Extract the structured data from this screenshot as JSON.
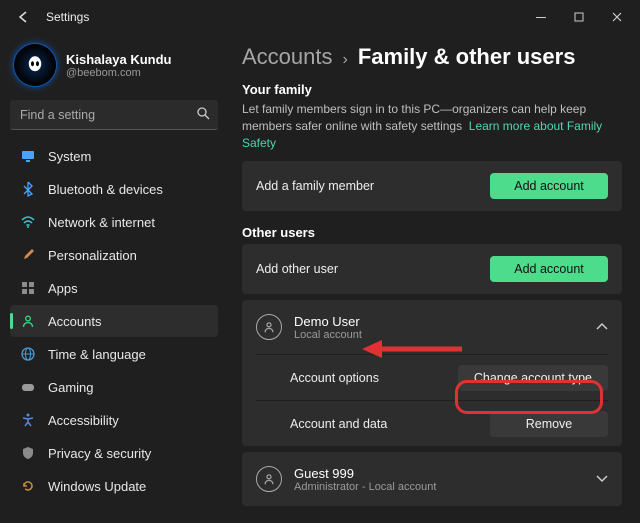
{
  "window": {
    "title": "Settings"
  },
  "user": {
    "name": "Kishalaya Kundu",
    "email": "@beebom.com"
  },
  "search": {
    "placeholder": "Find a setting"
  },
  "nav": [
    {
      "key": "system",
      "label": "System",
      "icon": "monitor",
      "color": "#4aa3ff"
    },
    {
      "key": "bluetooth",
      "label": "Bluetooth & devices",
      "icon": "bt",
      "color": "#4aa3ff"
    },
    {
      "key": "network",
      "label": "Network & internet",
      "icon": "wifi",
      "color": "#38c6c6"
    },
    {
      "key": "personalization",
      "label": "Personalization",
      "icon": "brush",
      "color": "#d08a4a"
    },
    {
      "key": "apps",
      "label": "Apps",
      "icon": "grid",
      "color": "#8c8c8c"
    },
    {
      "key": "accounts",
      "label": "Accounts",
      "icon": "person",
      "color": "#36d07a",
      "active": true
    },
    {
      "key": "time",
      "label": "Time & language",
      "icon": "globe",
      "color": "#4a9ad0"
    },
    {
      "key": "gaming",
      "label": "Gaming",
      "icon": "gamepad",
      "color": "#9a9a9a"
    },
    {
      "key": "accessibility",
      "label": "Accessibility",
      "icon": "access",
      "color": "#5a8ad0"
    },
    {
      "key": "privacy",
      "label": "Privacy & security",
      "icon": "shield",
      "color": "#8a8a8a"
    },
    {
      "key": "update",
      "label": "Windows Update",
      "icon": "refresh",
      "color": "#c4903a"
    }
  ],
  "breadcrumb": {
    "root": "Accounts",
    "sep": "›",
    "current": "Family & other users"
  },
  "family": {
    "heading": "Your family",
    "desc": "Let family members sign in to this PC—organizers can help keep members safer online with safety settings",
    "link": "Learn more about Family Safety",
    "add_label": "Add a family member",
    "add_btn": "Add account"
  },
  "other": {
    "heading": "Other users",
    "add_label": "Add other user",
    "add_btn": "Add account",
    "users": [
      {
        "name": "Demo User",
        "sub": "Local account",
        "expanded": true,
        "options_label": "Account options",
        "options_btn": "Change account type",
        "data_label": "Account and data",
        "data_btn": "Remove"
      },
      {
        "name": "Guest 999",
        "sub": "Administrator - Local account",
        "expanded": false
      }
    ]
  }
}
